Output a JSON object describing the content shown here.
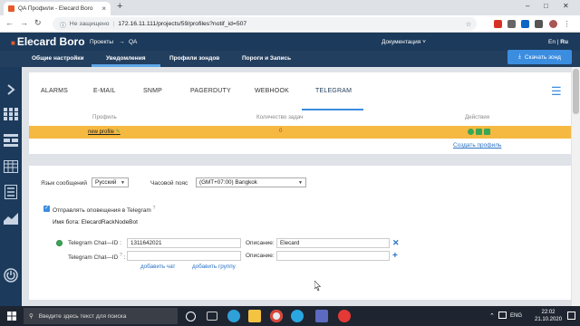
{
  "browser": {
    "tab_title": "QA Профили - Elecard Boro",
    "close_glyph": "×",
    "new_tab_glyph": "+",
    "security_text": "Не защищено",
    "url": "172.16.11.111/projects/59/profiles?notif_id=507"
  },
  "header": {
    "logo": "Elecard Boro",
    "projects_label": "Проекты",
    "arrow": "→",
    "project_name": "QA",
    "docs_label": "Документация",
    "lang_en": "En",
    "lang_ru": "Ru"
  },
  "subnav": {
    "items": [
      "Общие настройки",
      "Уведомления",
      "Профили зондов",
      "Пороги и Запись"
    ],
    "download_label": "Скачать зонд"
  },
  "notif_tabs": [
    "ALARMS",
    "E-MAIL",
    "SNMP",
    "PAGERDUTY",
    "WEBHOOK",
    "TELEGRAM"
  ],
  "table": {
    "col_profile": "Профиль",
    "col_tasks": "Количество задач",
    "col_actions": "Действия",
    "row_profile": "new profile",
    "row_count": "0",
    "create_profile": "Создать профиль"
  },
  "form": {
    "msg_lang_label": "Язык сообщений",
    "msg_lang_value": "Русский",
    "tz_label": "Часовой пояс",
    "tz_value": "(GMT+07:00) Bangkok",
    "send_label": "Отправлять оповещения в Telegram",
    "help_mark": "?",
    "bot_label": "Имя бота: ElecardRackNodeBot",
    "chat_label_1": "Telegram Chat—ID :",
    "chat_value_1": "1311642021",
    "desc_label_1": "Описание:",
    "desc_value_1": "Elecard",
    "chat_label_2": "Telegram Chat—ID",
    "desc_label_2": "Описание:",
    "add_chat": "добавить чат",
    "add_group": "добавить группу"
  },
  "taskbar": {
    "search_placeholder": "Введите здесь текст для поиска",
    "lang": "ENG",
    "time": "22:02",
    "date": "21.10.2020"
  },
  "colors": {
    "header_bg": "#1c3a5b",
    "accent": "#3b8de0",
    "highlight_row": "#f5b941"
  }
}
